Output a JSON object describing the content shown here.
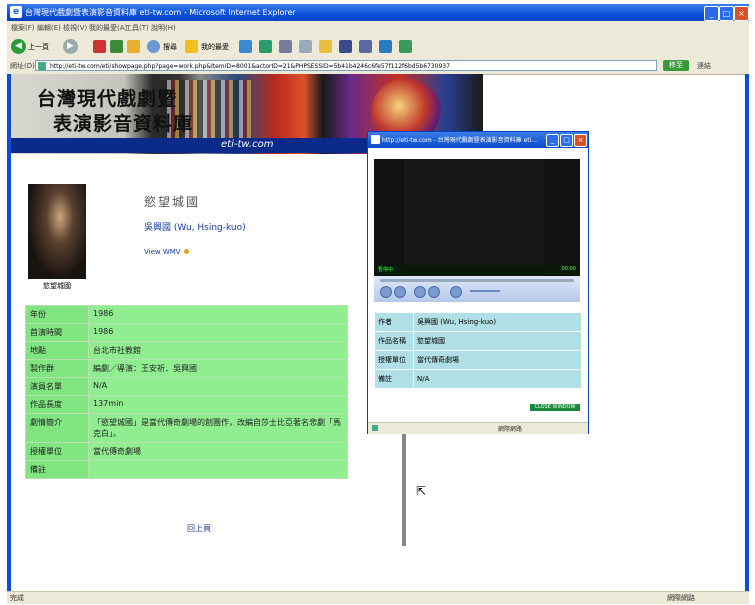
{
  "window": {
    "title": "台灣現代戲劇暨表演影音資料庫 eti-tw.com - Microsoft Internet Explorer",
    "menus": [
      "檔案(F)",
      "編輯(E)",
      "檢視(V)",
      "我的最愛(A)",
      "工具(T)",
      "說明(H)"
    ],
    "toolbar": {
      "back": "上一頁",
      "search": "搜尋",
      "favorites": "我的最愛"
    },
    "address_label": "網址(D)",
    "address": "http://eti-tw.com/eti/showpage.php?page=work.php&ItemID=8001&actorID=21&PHPSESSID=5b41b4246c6fe57f112f6bd5b6730937",
    "go_label": "移至",
    "links_label": "連結",
    "status_text": "完成",
    "status_zone": "網際網路"
  },
  "site": {
    "title_line1": "台灣現代戲劇暨",
    "title_line2": "表演影音資料庫",
    "domain": "eti-tw.com"
  },
  "work": {
    "title": "慾望城國",
    "author": "吳興國 (Wu, Hsing-kuo)",
    "wmv_link": "View WMV",
    "photo_caption": "慾望城國"
  },
  "info": [
    {
      "key": "年份",
      "value": "1986"
    },
    {
      "key": "首演時間",
      "value": "1986"
    },
    {
      "key": "地點",
      "value": "台北市社教館"
    },
    {
      "key": "製作群",
      "value": "編劇／導演：王安祈．吳興國"
    },
    {
      "key": "演員名單",
      "value": "N/A"
    },
    {
      "key": "作品長度",
      "value": "137min"
    },
    {
      "key": "劇情簡介",
      "value": "「慾望城國」是當代傳奇劇場的創團作，改編自莎士比亞著名悲劇「馬克白」。"
    },
    {
      "key": "授權單位",
      "value": "當代傳奇劇場"
    },
    {
      "key": "備註",
      "value": ""
    }
  ],
  "back_to_top": "回上頁",
  "popup": {
    "title": "http://eti-tw.com - 台灣現代戲劇暨表演影音資料庫 eti...",
    "player_status_left": "暫停中",
    "player_status_right": "00:00",
    "rows": [
      {
        "key": "作者",
        "value": "吳興國 (Wu, Hsing-kuo)"
      },
      {
        "key": "作品名稱",
        "value": "慾望城國"
      },
      {
        "key": "授權單位",
        "value": "當代傳奇劇場"
      },
      {
        "key": "備註",
        "value": "N/A"
      }
    ],
    "close_label": "CLOSE WINDOW",
    "status_zone": "網際網路"
  },
  "colors": {
    "ie_blue": "#0a4fd6",
    "table_green": "#90ee90",
    "popup_cell": "#b0dfe6",
    "site_bar": "#0b2a8a"
  }
}
